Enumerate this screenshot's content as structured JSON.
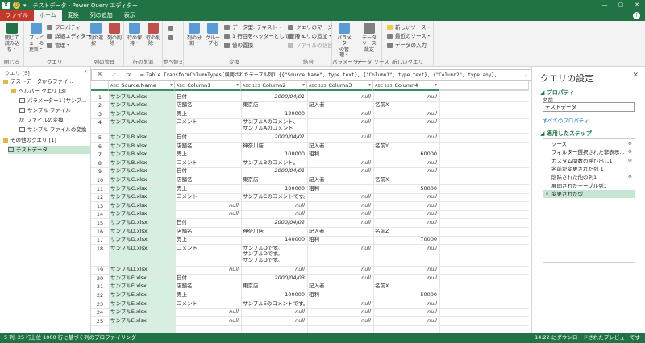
{
  "titlebar": {
    "app_icon": "X",
    "smile_icon": "☺",
    "qat": "▾",
    "title": "テストデータ - Power Query エディター",
    "minimize": "—",
    "maximize": "▢",
    "close": "✕"
  },
  "tabs": [
    "ファイル",
    "ホーム",
    "変換",
    "列の追加",
    "表示"
  ],
  "help_icon": "?",
  "ribbon": {
    "groups": {
      "close": {
        "label": "閉じる",
        "btn": "閉じて読み込む・"
      },
      "query": {
        "label": "クエリ",
        "preview": "プレビューの更新・",
        "props": "プロパティ",
        "adv": "詳細エディター",
        "manage": "管理・"
      },
      "colmgmt": {
        "label": "列の管理",
        "select": "列の選択・",
        "remove": "列の削除・"
      },
      "rowred": {
        "label": "行の削減",
        "keep": "行の保持・",
        "remove": "行の削除・"
      },
      "sort": {
        "label": "並べ替え"
      },
      "transform": {
        "label": "変換",
        "split": "列の分割・",
        "group": "グループ化",
        "dtype": "データ型: テキスト・",
        "header": "1 行目をヘッダーとして使用・",
        "replace": "値の置換"
      },
      "combine": {
        "label": "結合",
        "merge": "クエリのマージ・",
        "append": "クエリの追加・",
        "combine_files": "ファイルの結合"
      },
      "params": {
        "label": "パラメーター",
        "btn": "パラメーターの管理・"
      },
      "ds": {
        "label": "データ ソース",
        "btn": "データソース設定"
      },
      "newq": {
        "label": "新しいクエリ",
        "new": "新しいソース・",
        "recent": "最近のソース・",
        "enter": "データの入力"
      }
    }
  },
  "formula": {
    "cancel": "✕",
    "confirm": "✓",
    "fx": "fx",
    "text": "= Table.TransformColumnTypes(展開されたテーブル列1,{{\"Source.Name\", type text}, {\"Column1\", type text}, {\"Column2\", type any},",
    "expand": "⌄"
  },
  "queries": {
    "header": "クエリ [5]",
    "collapse": "‹",
    "items": [
      {
        "label": "テストデータからファイ...",
        "kind": "folder"
      },
      {
        "label": "ヘルパー クエリ [3]",
        "kind": "folder"
      },
      {
        "label": "パラメーター1 (サンプ...",
        "kind": "table"
      },
      {
        "label": "サンプル ファイル",
        "kind": "table"
      },
      {
        "label": "ファイルの変換",
        "kind": "fx"
      },
      {
        "label": "サンプル ファイルの変換",
        "kind": "table"
      },
      {
        "label": "その他のクエリ [1]",
        "kind": "folder"
      },
      {
        "label": "テストデータ",
        "kind": "table"
      }
    ]
  },
  "grid": {
    "columns": [
      {
        "type": "ABC",
        "name": "Source.Name"
      },
      {
        "type": "ABC",
        "name": "Column1"
      },
      {
        "type": "ABC 123",
        "name": "Column2"
      },
      {
        "type": "ABC 123",
        "name": "Column3"
      },
      {
        "type": "ABC 123",
        "name": "Column4"
      }
    ],
    "rows": [
      {
        "n": "1",
        "c": [
          "サンプルA.xlsx",
          "日付",
          "2000/04/01",
          "null",
          "null"
        ]
      },
      {
        "n": "2",
        "c": [
          "サンプルA.xlsx",
          "店舗名",
          "東京店",
          "記入者",
          "名前X"
        ]
      },
      {
        "n": "3",
        "c": [
          "サンプルA.xlsx",
          "売上",
          "120000",
          "null",
          "null"
        ]
      },
      {
        "n": "4",
        "c": [
          "サンプルA.xlsx",
          "コメント",
          "サンプルAのコメント、\nサンプルAのコメント",
          "null",
          "null"
        ]
      },
      {
        "n": "5",
        "c": [
          "サンプルB.xlsx",
          "日付",
          "2000/04/01",
          "null",
          "null"
        ]
      },
      {
        "n": "6",
        "c": [
          "サンプルB.xlsx",
          "店舗名",
          "神奈川店",
          "記入者",
          "名前Y"
        ]
      },
      {
        "n": "7",
        "c": [
          "サンプルB.xlsx",
          "売上",
          "100000",
          "粗利",
          "60000"
        ]
      },
      {
        "n": "8",
        "c": [
          "サンプルB.xlsx",
          "コメント",
          "サンプルBのコメント。",
          "null",
          "null"
        ]
      },
      {
        "n": "9",
        "c": [
          "サンプルC.xlsx",
          "日付",
          "2000/04/01",
          "null",
          "null"
        ]
      },
      {
        "n": "10",
        "c": [
          "サンプルC.xlsx",
          "店舗名",
          "東京店",
          "記入者",
          "名前X"
        ]
      },
      {
        "n": "11",
        "c": [
          "サンプルC.xlsx",
          "売上",
          "100000",
          "粗利",
          "50000"
        ]
      },
      {
        "n": "12",
        "c": [
          "サンプルC.xlsx",
          "コメント",
          "サンプルCのコメントです。",
          "null",
          "null"
        ]
      },
      {
        "n": "13",
        "c": [
          "サンプルC.xlsx",
          "null",
          "null",
          "null",
          "null"
        ]
      },
      {
        "n": "14",
        "c": [
          "サンプルC.xlsx",
          "null",
          "null",
          "null",
          "null"
        ]
      },
      {
        "n": "15",
        "c": [
          "サンプルD.xlsx",
          "日付",
          "2000/04/02",
          "null",
          "null"
        ]
      },
      {
        "n": "16",
        "c": [
          "サンプルD.xlsx",
          "店舗名",
          "神奈川店",
          "記入者",
          "名前Z"
        ]
      },
      {
        "n": "17",
        "c": [
          "サンプルD.xlsx",
          "売上",
          "140000",
          "粗利",
          "70000"
        ]
      },
      {
        "n": "18",
        "c": [
          "サンプルD.xlsx",
          "コメント",
          "サンプルDです。\nサンプルDです。\nサンプルDです。",
          "null",
          "null"
        ]
      },
      {
        "n": "19",
        "c": [
          "サンプルD.xlsx",
          "null",
          "null",
          "null",
          "null"
        ]
      },
      {
        "n": "20",
        "c": [
          "サンプルE.xlsx",
          "日付",
          "2000/04/03",
          "null",
          "null"
        ]
      },
      {
        "n": "21",
        "c": [
          "サンプルE.xlsx",
          "店舗名",
          "東京店",
          "記入者",
          "名前X"
        ]
      },
      {
        "n": "22",
        "c": [
          "サンプルE.xlsx",
          "売上",
          "100000",
          "粗利",
          "50000"
        ]
      },
      {
        "n": "23",
        "c": [
          "サンプルE.xlsx",
          "コメント",
          "サンプルEのコメントです。",
          "null",
          "null"
        ]
      },
      {
        "n": "24",
        "c": [
          "サンプルE.xlsx",
          "null",
          "null",
          "null",
          "null"
        ]
      },
      {
        "n": "25",
        "c": [
          "サンプルE.xlsx",
          "null",
          "null",
          "null",
          "null"
        ]
      }
    ]
  },
  "settings": {
    "title": "クエリの設定",
    "close": "✕",
    "props_header": "◢ プロパティ",
    "name_label": "名前",
    "name_value": "テストデータ",
    "all_props": "すべてのプロパティ",
    "steps_header": "◢ 適用したステップ",
    "steps": [
      {
        "label": "ソース",
        "gear": true
      },
      {
        "label": "フィルター選択された非表示...",
        "gear": true
      },
      {
        "label": "カスタム関数の呼び出し1",
        "gear": true
      },
      {
        "label": "名前が変更された列 1",
        "gear": false
      },
      {
        "label": "削除された他の列1",
        "gear": true
      },
      {
        "label": "展開されたテーブル列1",
        "gear": false
      },
      {
        "label": "変更された型",
        "gear": false,
        "selected": true
      }
    ],
    "gear_icon": "⚙",
    "delete_icon": "✕"
  },
  "status": {
    "left": "5 列, 25 行",
    "mid": "上位 1000 行に基づく列のプロファイリング",
    "right": "14:22 にダウンロードされたプレビューです"
  },
  "colors": {
    "brand": "#217346",
    "source_col": "#d6efe0",
    "selected": "#c6e6d2"
  }
}
